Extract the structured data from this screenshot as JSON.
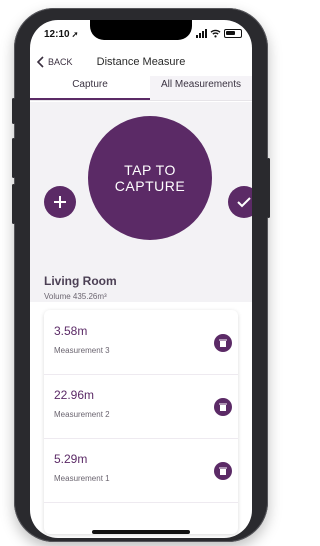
{
  "status_bar": {
    "time": "12:10"
  },
  "nav": {
    "back_label": "BACK",
    "title": "Distance Measure"
  },
  "tabs": [
    {
      "label": "Capture"
    },
    {
      "label": "All Measurements"
    }
  ],
  "capture": {
    "line1": "TAP TO",
    "line2": "CAPTURE",
    "add_icon": "plus-icon",
    "confirm_icon": "check-icon"
  },
  "room": {
    "name": "Living Room",
    "volume": "Volume 435.26m³"
  },
  "measurements": [
    {
      "value": "3.58m",
      "label": "Measurement 3",
      "delete_icon": "trash-icon"
    },
    {
      "value": "22.96m",
      "label": "Measurement 2",
      "delete_icon": "trash-icon"
    },
    {
      "value": "5.29m",
      "label": "Measurement 1",
      "delete_icon": "trash-icon"
    }
  ],
  "colors": {
    "accent": "#5b2a66",
    "background": "#f3f2f5"
  }
}
